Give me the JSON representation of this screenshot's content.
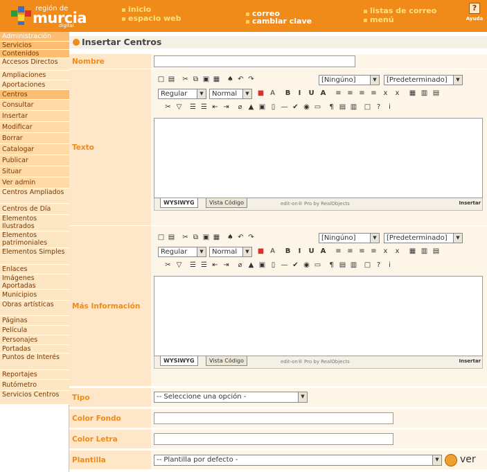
{
  "header": {
    "logo": {
      "line1": "región de",
      "line2": "murcia",
      "line3": "digital"
    },
    "nav": {
      "inicio": "inicio",
      "espacio_web": "espacio web",
      "correo": "correo",
      "cambiar_clave": "cambiar clave",
      "listas_correo": "listas de correo",
      "menu": "menú"
    },
    "help": {
      "icon": "?",
      "label": "Ayuda"
    }
  },
  "sidebar": {
    "items": [
      {
        "label": "Administración",
        "style": "h1"
      },
      {
        "label": "Servicios",
        "style": "i"
      },
      {
        "label": "Contenidos",
        "style": "i"
      },
      {
        "label": "Accesos Directos",
        "style": "w"
      },
      {
        "label": "Ampliaciones",
        "style": "w"
      },
      {
        "label": "Aportaciones",
        "style": "w"
      },
      {
        "label": "Centros",
        "style": "i"
      },
      {
        "label": "Consultar",
        "style": "s"
      },
      {
        "label": "Insertar",
        "style": "s"
      },
      {
        "label": "Modificar",
        "style": "s"
      },
      {
        "label": "Borrar",
        "style": "s"
      },
      {
        "label": "Catalogar",
        "style": "s"
      },
      {
        "label": "Publicar",
        "style": "s"
      },
      {
        "label": "Situar",
        "style": "s"
      },
      {
        "label": "Ver admin",
        "style": "s"
      },
      {
        "label": "Centros Ampliados",
        "style": "w"
      },
      {
        "label": "Centros de Día",
        "style": "w"
      },
      {
        "label": "Elementos Ilustrados",
        "style": "w"
      },
      {
        "label": "Elementos patrimoniales",
        "style": "w"
      },
      {
        "label": "Elementos Simples",
        "style": "w"
      },
      {
        "label": "Enlaces",
        "style": "w"
      },
      {
        "label": "Imágenes Aportadas",
        "style": "w"
      },
      {
        "label": "Municipios",
        "style": "w"
      },
      {
        "label": "Obras artísticas",
        "style": "w"
      },
      {
        "label": "Páginas",
        "style": "w"
      },
      {
        "label": "Película",
        "style": "w"
      },
      {
        "label": "Personajes",
        "style": "w"
      },
      {
        "label": "Portadas",
        "style": "w"
      },
      {
        "label": "Puntos de Interés",
        "style": "w"
      },
      {
        "label": "Reportajes",
        "style": "w"
      },
      {
        "label": "Rutómetro",
        "style": "w"
      },
      {
        "label": "Servicios Centros",
        "style": "w"
      }
    ]
  },
  "main": {
    "title": "Insertar Centros",
    "labels": {
      "nombre": "Nombre",
      "texto": "Texto",
      "mas_info": "Más Información",
      "tipo": "Tipo",
      "color_fondo": "Color Fondo",
      "color_letra": "Color Letra",
      "plantilla": "Plantilla"
    },
    "tipo_value": "-- Seleccione una opción -",
    "plantilla_value": "-- Plantilla por defecto -",
    "ver": "ver"
  },
  "editor": {
    "format_value": "[Ningúno]",
    "font_value": "[Predeterminado]",
    "style_value": "Regular",
    "size_value": "Normal",
    "tab_wysiwyg": "WYSIWYG",
    "tab_code": "Vista Código",
    "credit": "edit-on® Pro by RealObjects",
    "insert": "Insertar"
  }
}
